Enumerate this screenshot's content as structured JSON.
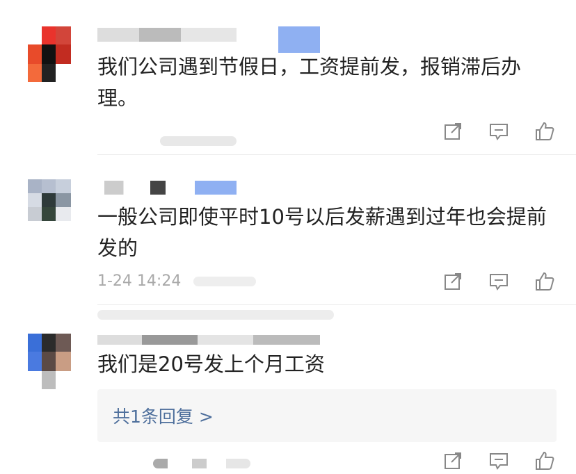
{
  "comments": [
    {
      "text": "我们公司遇到节假日，工资提前发，报销滞后办理。",
      "meta": "",
      "actions": {
        "share": "share-icon",
        "reply": "comment-icon",
        "like": "thumbs-up-icon"
      }
    },
    {
      "text": "一般公司即使平时10号以后发薪遇到过年也会提前发的",
      "meta": "1-24 14:24",
      "actions": {
        "share": "share-icon",
        "reply": "comment-icon",
        "like": "thumbs-up-icon"
      }
    },
    {
      "text": "我们是20号发上个月工资",
      "meta": "",
      "reply_summary": "共1条回复 >",
      "actions": {
        "share": "share-icon",
        "reply": "comment-icon",
        "like": "thumbs-up-icon"
      }
    }
  ]
}
